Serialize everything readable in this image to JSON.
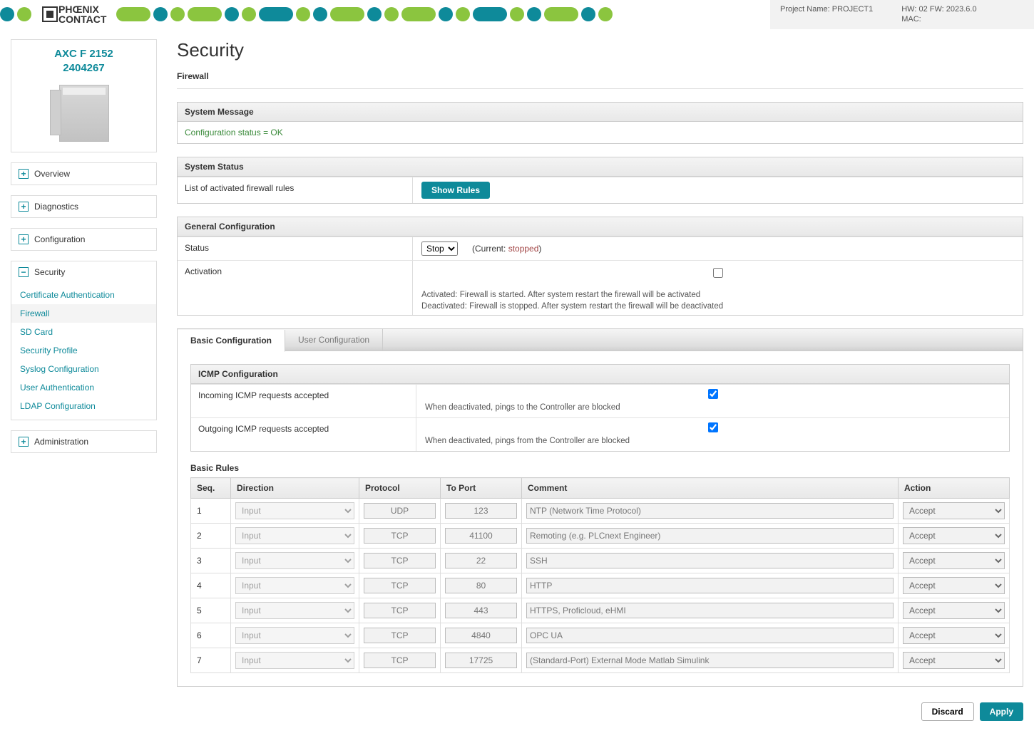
{
  "header": {
    "project_label": "Project Name:",
    "project_name": "PROJECT1",
    "hw_label": "HW: 02 FW: 2023.6.0",
    "mac_label": "MAC:"
  },
  "device": {
    "line1": "AXC F 2152",
    "line2": "2404267"
  },
  "nav": {
    "overview": "Overview",
    "diagnostics": "Diagnostics",
    "configuration": "Configuration",
    "security": "Security",
    "administration": "Administration",
    "security_items": {
      "cert": "Certificate Authentication",
      "firewall": "Firewall",
      "sd": "SD Card",
      "profile": "Security Profile",
      "syslog": "Syslog Configuration",
      "userauth": "User Authentication",
      "ldap": "LDAP Configuration"
    }
  },
  "page": {
    "title": "Security",
    "subtitle": "Firewall"
  },
  "system_message": {
    "header": "System Message",
    "text": "Configuration status = OK"
  },
  "system_status": {
    "header": "System Status",
    "label": "List of activated firewall rules",
    "button": "Show Rules"
  },
  "general": {
    "header": "General Configuration",
    "status_label": "Status",
    "status_value": "Stop",
    "current_label": "(Current: ",
    "current_value": "stopped",
    "current_close": ")",
    "activation_label": "Activation",
    "note1": "Activated: Firewall is started. After system restart the firewall will be activated",
    "note2": "Deactivated: Firewall is stopped. After system restart the firewall will be deactivated"
  },
  "tabs": {
    "basic": "Basic Configuration",
    "user": "User Configuration"
  },
  "icmp": {
    "header": "ICMP Configuration",
    "in_label": "Incoming ICMP requests accepted",
    "in_note": "When deactivated, pings to the Controller are blocked",
    "out_label": "Outgoing ICMP requests accepted",
    "out_note": "When deactivated, pings from the Controller are blocked"
  },
  "rules": {
    "title": "Basic Rules",
    "headers": {
      "seq": "Seq.",
      "direction": "Direction",
      "protocol": "Protocol",
      "toport": "To Port",
      "comment": "Comment",
      "action": "Action"
    },
    "items": [
      {
        "seq": "1",
        "direction": "Input",
        "protocol": "UDP",
        "port": "123",
        "comment": "NTP (Network Time Protocol)",
        "action": "Accept"
      },
      {
        "seq": "2",
        "direction": "Input",
        "protocol": "TCP",
        "port": "41100",
        "comment": "Remoting (e.g. PLCnext Engineer)",
        "action": "Accept"
      },
      {
        "seq": "3",
        "direction": "Input",
        "protocol": "TCP",
        "port": "22",
        "comment": "SSH",
        "action": "Accept"
      },
      {
        "seq": "4",
        "direction": "Input",
        "protocol": "TCP",
        "port": "80",
        "comment": "HTTP",
        "action": "Accept"
      },
      {
        "seq": "5",
        "direction": "Input",
        "protocol": "TCP",
        "port": "443",
        "comment": "HTTPS, Proficloud, eHMI",
        "action": "Accept"
      },
      {
        "seq": "6",
        "direction": "Input",
        "protocol": "TCP",
        "port": "4840",
        "comment": "OPC UA",
        "action": "Accept"
      },
      {
        "seq": "7",
        "direction": "Input",
        "protocol": "TCP",
        "port": "17725",
        "comment": "(Standard-Port) External Mode Matlab Simulink",
        "action": "Accept"
      }
    ]
  },
  "footer": {
    "discard": "Discard",
    "apply": "Apply"
  }
}
